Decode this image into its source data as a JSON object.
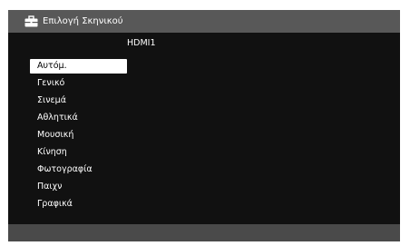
{
  "header": {
    "title": "Επιλογή Σκηνικού",
    "icon": "briefcase-icon"
  },
  "source": {
    "label": "HDMI1"
  },
  "scene_modes": {
    "selected_index": 0,
    "items": [
      {
        "label": "Αυτόμ."
      },
      {
        "label": "Γενικό"
      },
      {
        "label": "Σινεμά"
      },
      {
        "label": "Αθλητικά"
      },
      {
        "label": "Μουσική"
      },
      {
        "label": "Κίνηση"
      },
      {
        "label": "Φωτογραφία"
      },
      {
        "label": "Παιχν"
      },
      {
        "label": "Γραφικά"
      }
    ]
  },
  "colors": {
    "panel_background": "#111111",
    "header_background": "#585858",
    "footer_background": "#4a4a4a",
    "selected_background": "#ffffff",
    "text": "#ffffff",
    "selected_text": "#000000"
  }
}
